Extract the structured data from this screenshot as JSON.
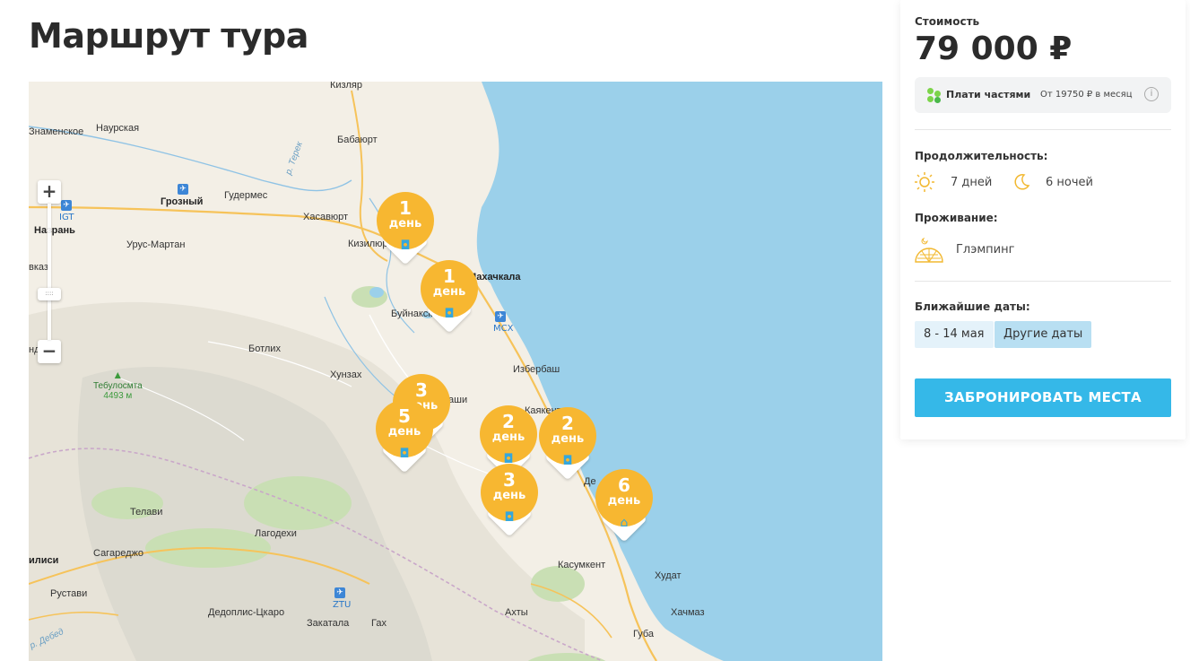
{
  "page": {
    "title": "Маршрут тура"
  },
  "map": {
    "places": {
      "kizlyar": "Кизляр",
      "naurskaya": "Наурская",
      "znamenskoe": "Знаменское",
      "babayurt": "Бабаюрт",
      "terek": "р. Терек",
      "grozny": "Грозный",
      "gudermes": "Гудермес",
      "khasavyurt": "Хасавюрт",
      "igt": "IGT",
      "nazran": "Назрань",
      "urus_martan": "Урус-Мартан",
      "kiziljurt": "Кизилюрт",
      "makhachkala": "Махачкала",
      "kavkaz": "вказ",
      "buynaksk": "Буйнакск",
      "mcx": "МСХ",
      "botlikh": "Ботлих",
      "khunzakh": "Хунзах",
      "izberbash": "Избербаш",
      "tebulosmta": "Тебулосмта",
      "tebulosmta_height": "4493 м",
      "ami": "аши",
      "kayakent": "Каякент",
      "derbent": "Де",
      "telavi": "Телави",
      "lagodekhi": "Лагодехи",
      "sagaredzho": "Сагареджо",
      "tbilisi": "илиси",
      "rustavi": "Рустави",
      "kasumkent": "Касумкент",
      "khudat": "Худат",
      "dedoplis": "Дедоплис-Цкаро",
      "ztu": "ZTU",
      "zakatala": "Закатала",
      "akhty": "Ахты",
      "khachmaz": "Хачмаз",
      "gakh": "Гах",
      "debed": "р. Дебед",
      "guba": "Губа",
      "nd": "нд"
    },
    "zoom": {
      "plus": "+",
      "minus": "−",
      "knob": "::::"
    },
    "pins": [
      {
        "num": "1",
        "day": "день",
        "icon": "camera-icon"
      },
      {
        "num": "1",
        "day": "день",
        "icon": "camera-icon"
      },
      {
        "num": "3",
        "day": "день",
        "icon": "camera-icon"
      },
      {
        "num": "5",
        "day": "день",
        "icon": "camera-icon"
      },
      {
        "num": "2",
        "day": "день",
        "icon": "camera-icon"
      },
      {
        "num": "2",
        "day": "день",
        "icon": "camera-icon"
      },
      {
        "num": "3",
        "day": "день",
        "icon": "camera-icon"
      },
      {
        "num": "6",
        "day": "день",
        "icon": "museum-icon"
      }
    ],
    "colors": {
      "sea": "#9bd0ea",
      "land": "#f3efe6",
      "forest": "#c9dfb4",
      "pin": "#f7b731",
      "road": "#f6c35a"
    }
  },
  "sidebar": {
    "price_label": "Стоимость",
    "price": "79 000 ₽",
    "installment": {
      "name": "Плати частями",
      "from": "От 19750 ₽ в месяц",
      "info": "i"
    },
    "duration_label": "Продолжительность:",
    "days": "7 дней",
    "nights": "6 ночей",
    "accommodation_label": "Проживание:",
    "accommodation": "Глэмпинг",
    "dates_label": "Ближайшие даты:",
    "date_chip": "8 - 14 мая",
    "other_dates": "Другие даты",
    "book_button": "ЗАБРОНИРОВАТЬ МЕСТА",
    "accent_color": "#35b8e8"
  }
}
